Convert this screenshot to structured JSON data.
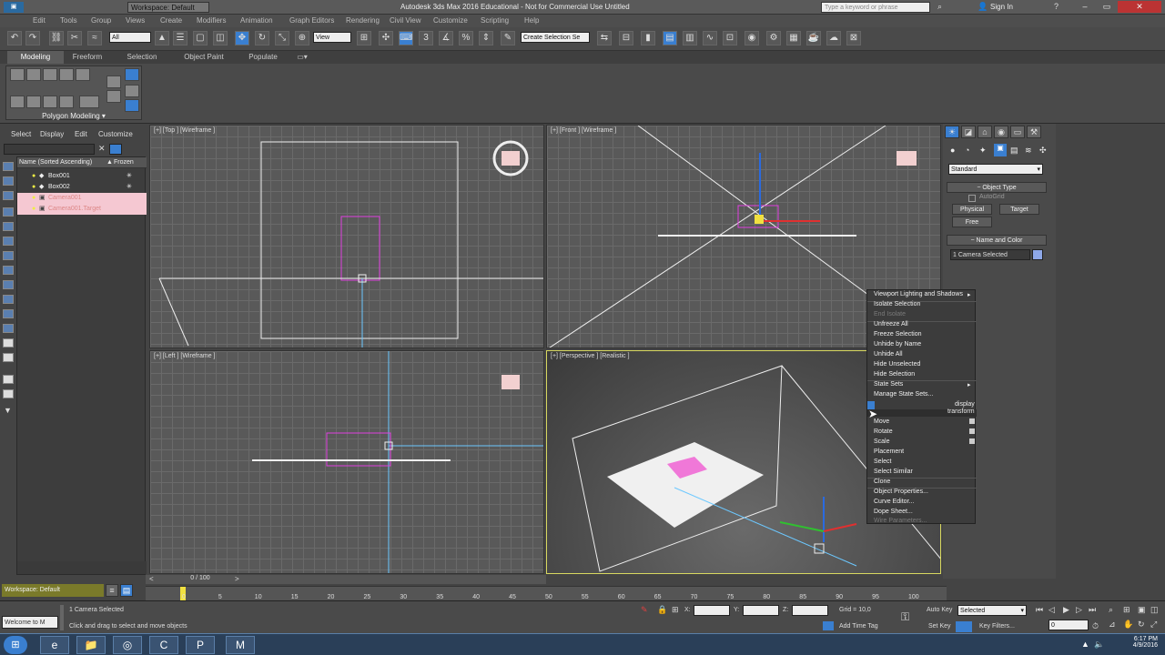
{
  "titlebar": {
    "title": "Autodesk 3ds Max 2016 Educational - Not for Commercial Use   Untitled",
    "workspace": "Workspace: Default",
    "search_placeholder": "Type a keyword or phrase",
    "sign_in": "Sign In"
  },
  "menubar": [
    "Edit",
    "Tools",
    "Group",
    "Views",
    "Create",
    "Modifiers",
    "Animation",
    "Graph Editors",
    "Rendering",
    "Civil View",
    "Customize",
    "Scripting",
    "Help"
  ],
  "toolbar": {
    "selection_filter": "All",
    "ref_coord": "View",
    "named_selection": "Create Selection Se"
  },
  "ribbon": {
    "tabs": [
      "Modeling",
      "Freeform",
      "Selection",
      "Object Paint",
      "Populate"
    ],
    "panel_label": "Polygon Modeling"
  },
  "scene_explorer": {
    "tabs": [
      "Select",
      "Display",
      "Edit",
      "Customize"
    ],
    "col_name": "Name (Sorted Ascending)",
    "col_frozen": "Frozen",
    "rows": [
      {
        "name": "Box001",
        "selected": false
      },
      {
        "name": "Box002",
        "selected": false
      },
      {
        "name": "Camera001",
        "selected": true
      },
      {
        "name": "Camera001.Target",
        "selected": true
      }
    ],
    "workspace": "Workspace: Default"
  },
  "viewports": {
    "top": "[+] [Top ] [Wireframe ]",
    "front": "[+] [Front ] [Wireframe ]",
    "left": "[+] [Left ] [Wireframe ]",
    "persp": "[+] [Perspective ] [Realistic ]"
  },
  "command_panel": {
    "category": "Standard",
    "object_type": "Object Type",
    "autogrid": "AutoGrid",
    "buttons": [
      "Physical",
      "Target",
      "Free"
    ],
    "name_color": "Name and Color",
    "name_value": "1 Camera Selected"
  },
  "quad_menu": {
    "items": [
      {
        "label": "Viewport Lighting and Shadows",
        "disabled": false
      },
      {
        "label": "Isolate Selection",
        "disabled": false
      },
      {
        "label": "End Isolate",
        "disabled": true
      },
      {
        "label": "Unfreeze All",
        "disabled": false
      },
      {
        "label": "Freeze Selection",
        "disabled": false
      },
      {
        "label": "Unhide by Name",
        "disabled": false
      },
      {
        "label": "Unhide All",
        "disabled": false
      },
      {
        "label": "Hide Unselected",
        "disabled": false
      },
      {
        "label": "Hide Selection",
        "disabled": false
      },
      {
        "label": "State Sets",
        "disabled": false
      },
      {
        "label": "Manage State Sets...",
        "disabled": false
      }
    ],
    "quadrant_display": "display",
    "quadrant_transform": "transform",
    "items2": [
      {
        "label": "Move",
        "disabled": false
      },
      {
        "label": "Rotate",
        "disabled": false
      },
      {
        "label": "Scale",
        "disabled": false
      },
      {
        "label": "Placement",
        "disabled": false
      },
      {
        "label": "Select",
        "disabled": false
      },
      {
        "label": "Select Similar",
        "disabled": false
      },
      {
        "label": "Clone",
        "disabled": false
      },
      {
        "label": "Object Properties...",
        "disabled": false
      },
      {
        "label": "Curve Editor...",
        "disabled": false
      },
      {
        "label": "Dope Sheet...",
        "disabled": false
      },
      {
        "label": "Wire Parameters...",
        "disabled": true
      }
    ]
  },
  "timeline": {
    "frame": "0 / 100",
    "ticks": [
      "0",
      "5",
      "10",
      "15",
      "20",
      "25",
      "30",
      "35",
      "40",
      "45",
      "50",
      "55",
      "60",
      "65",
      "70",
      "75",
      "80",
      "85",
      "90",
      "95",
      "100"
    ]
  },
  "status": {
    "selected": "1 Camera Selected",
    "prompt": "Click and drag to select and move objects",
    "listener": "Welcome to M",
    "x_label": "X:",
    "y_label": "Y:",
    "z_label": "Z:",
    "grid": "Grid = 10,0",
    "add_time_tag": "Add Time Tag",
    "auto_key": "Auto Key",
    "set_key": "Set Key",
    "key_filter_value": "Selected",
    "key_filters": "Key Filters...",
    "frame_field": "0"
  },
  "taskbar": {
    "time": "6:17 PM",
    "date": "4/9/2016"
  }
}
